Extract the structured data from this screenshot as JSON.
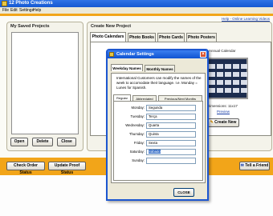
{
  "window": {
    "title": "12 Photo Creations"
  },
  "menu": [
    "File",
    "Edit",
    "Settings",
    "Help"
  ],
  "help_link": "Help - Online Learning Videos",
  "saved_projects": {
    "title": "My Saved Projects",
    "buttons": {
      "open": "Open",
      "delete": "Delete",
      "close": "Close"
    }
  },
  "create_project": {
    "title": "Create New Project",
    "tabs": [
      "Photo Calendars",
      "Photo Books",
      "Photo Cards",
      "Photo Posters"
    ],
    "calendar_name": "Annual Calendar",
    "dimensions": "Dimensions: 11x17",
    "preview_link": "Preview",
    "create_button": "Create New"
  },
  "bottom_buttons": {
    "order_status": "Check Order Status",
    "proof_status": "Update Proof Status",
    "tell_friend": "Tell a Friend"
  },
  "dialog": {
    "title": "Calendar Settings",
    "tabs": [
      "Weekday Names",
      "Monthly Names"
    ],
    "info": "International Customers can modify the names of the week to accomodate their language. I.e. Monday = Lunes for Spanish.",
    "subtabs": [
      "Regular",
      "Abbreviated",
      "Previous/Next Months"
    ],
    "days": [
      {
        "label": "Monday:",
        "value": "Segunda"
      },
      {
        "label": "Tuesday:",
        "value": "Terça"
      },
      {
        "label": "Wednesday:",
        "value": "Quarta"
      },
      {
        "label": "Thursday:",
        "value": "Quinta"
      },
      {
        "label": "Friday:",
        "value": "Sexta"
      },
      {
        "label": "Saturday:",
        "value": "Sábado"
      },
      {
        "label": "Sunday:",
        "value": ""
      }
    ],
    "close_button": "CLOSE"
  }
}
